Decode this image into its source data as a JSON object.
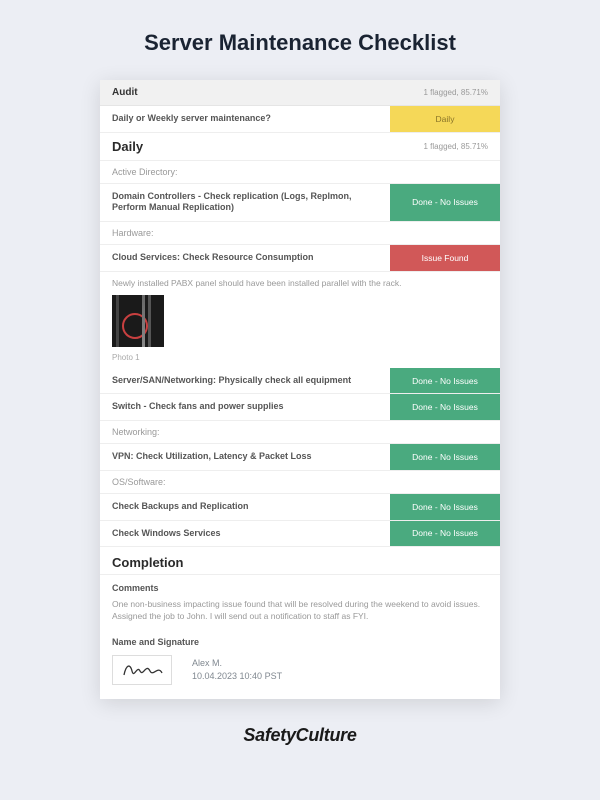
{
  "page_title": "Server Maintenance Checklist",
  "audit": {
    "title": "Audit",
    "flagged": "1 flagged, 85.71%"
  },
  "frequency_row": {
    "label": "Daily or Weekly server maintenance?",
    "value": "Daily"
  },
  "daily": {
    "title": "Daily",
    "flagged": "1 flagged, 85.71%"
  },
  "subheadings": {
    "active_directory": "Active Directory:",
    "hardware": "Hardware:",
    "networking": "Networking:",
    "os_software": "OS/Software:"
  },
  "items": {
    "domain_controllers": {
      "label": "Domain Controllers - Check replication (Logs, Replmon, Perform Manual Replication)",
      "status": "Done - No Issues"
    },
    "cloud_services": {
      "label": "Cloud Services: Check Resource Consumption",
      "status": "Issue Found"
    },
    "cloud_note": "Newly installed PABX panel should have been installed parallel with the rack.",
    "photo_caption": "Photo 1",
    "server_san": {
      "label": "Server/SAN/Networking: Physically check all equipment",
      "status": "Done - No Issues"
    },
    "switch": {
      "label": "Switch -  Check fans and power supplies",
      "status": "Done - No Issues"
    },
    "vpn": {
      "label": "VPN: Check Utilization, Latency & Packet Loss",
      "status": "Done - No Issues"
    },
    "backups": {
      "label": "Check Backups and Replication",
      "status": "Done - No Issues"
    },
    "windows_services": {
      "label": "Check Windows Services",
      "status": "Done - No Issues"
    }
  },
  "completion": {
    "title": "Completion",
    "comments_label": "Comments",
    "comments_body": "One non-business impacting issue found that will be resolved during the weekend to avoid issues. Assigned the job to John. I will send out a notification to staff as FYI.",
    "sig_label": "Name and Signature",
    "sig_name": "Alex M.",
    "sig_datetime": "10.04.2023 10:40 PST"
  },
  "brand": "SafetyCulture"
}
